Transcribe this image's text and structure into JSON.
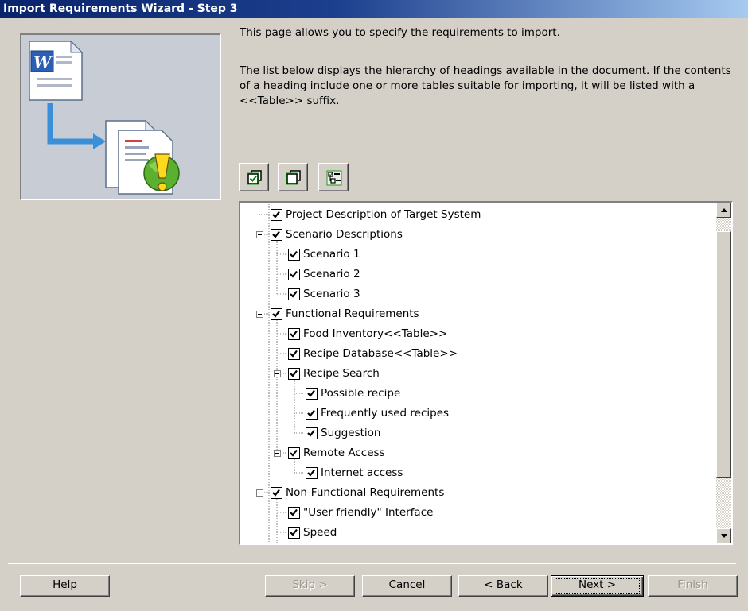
{
  "window": {
    "title": "Import Requirements Wizard - Step 3"
  },
  "description": {
    "line1": "This page allows you to specify the requirements to import.",
    "line2": "The list below displays the hierarchy of headings available in the document. If the contents of a heading include one or more tables suitable for importing, it will be listed with a <<Table>> suffix."
  },
  "toolbar": {
    "buttons": [
      {
        "name": "check-all",
        "icon": "check-all-icon"
      },
      {
        "name": "uncheck-all",
        "icon": "uncheck-all-icon"
      },
      {
        "name": "check-tables",
        "icon": "check-tables-icon"
      }
    ]
  },
  "tree": {
    "items": [
      {
        "label": "Project Description of Target System",
        "level": 0,
        "checked": true
      },
      {
        "label": "Scenario Descriptions",
        "level": 0,
        "checked": true,
        "expanded": true
      },
      {
        "label": "Scenario 1",
        "level": 1,
        "checked": true
      },
      {
        "label": "Scenario 2",
        "level": 1,
        "checked": true
      },
      {
        "label": "Scenario 3",
        "level": 1,
        "checked": true
      },
      {
        "label": "Functional Requirements",
        "level": 0,
        "checked": true,
        "expanded": true
      },
      {
        "label": "Food Inventory<<Table>>",
        "level": 1,
        "checked": true
      },
      {
        "label": "Recipe Database<<Table>>",
        "level": 1,
        "checked": true
      },
      {
        "label": "Recipe Search",
        "level": 1,
        "checked": true,
        "expanded": true
      },
      {
        "label": "Possible recipe",
        "level": 2,
        "checked": true
      },
      {
        "label": "Frequently used recipes",
        "level": 2,
        "checked": true
      },
      {
        "label": "Suggestion",
        "level": 2,
        "checked": true
      },
      {
        "label": "Remote Access",
        "level": 1,
        "checked": true,
        "expanded": true
      },
      {
        "label": "Internet access",
        "level": 2,
        "checked": true
      },
      {
        "label": "Non-Functional Requirements",
        "level": 0,
        "checked": true,
        "expanded": true
      },
      {
        "label": "\"User friendly\" Interface",
        "level": 1,
        "checked": true
      },
      {
        "label": "Speed",
        "level": 1,
        "checked": true
      }
    ]
  },
  "buttons": {
    "help": "Help",
    "skip": "Skip >",
    "cancel": "Cancel",
    "back": "< Back",
    "next": "Next >",
    "finish": "Finish"
  },
  "colors": {
    "titlebar_start": "#0a246a",
    "titlebar_end": "#a6caf0",
    "dialog_bg": "#d4d0c8"
  }
}
